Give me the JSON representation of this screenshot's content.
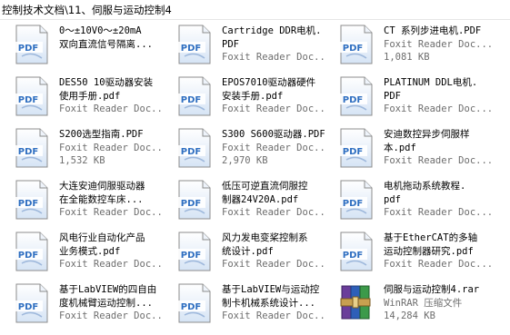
{
  "window": {
    "title": "控制技术文档\\11、伺服与运动控制4"
  },
  "files": [
    {
      "type": "pdf",
      "name_lines": [
        "0～±10V0～±20mA",
        "双向直流信号隔离..."
      ],
      "sub": ""
    },
    {
      "type": "pdf",
      "name_lines": [
        "Cartridge DDR电机.",
        "PDF"
      ],
      "sub": "Foxit Reader Doc..."
    },
    {
      "type": "pdf",
      "name_lines": [
        "CT 系列步进电机.PDF"
      ],
      "sub": "Foxit Reader Doc...",
      "size": "1,081 KB"
    },
    {
      "type": "pdf",
      "name_lines": [
        "DES50 10驱动器安装",
        "使用手册.pdf"
      ],
      "sub": "Foxit Reader Doc..."
    },
    {
      "type": "pdf",
      "name_lines": [
        "EPOS7010驱动器硬件",
        "安装手册.pdf"
      ],
      "sub": "Foxit Reader Doc..."
    },
    {
      "type": "pdf",
      "name_lines": [
        "PLATINUM DDL电机.",
        "PDF"
      ],
      "sub": "Foxit Reader Doc..."
    },
    {
      "type": "pdf",
      "name_lines": [
        "S200选型指南.PDF"
      ],
      "sub": "Foxit Reader Doc...",
      "size": "1,532 KB"
    },
    {
      "type": "pdf",
      "name_lines": [
        "S300 S600驱动器.PDF"
      ],
      "sub": "Foxit Reader Doc...",
      "size": "2,970 KB"
    },
    {
      "type": "pdf",
      "name_lines": [
        "安迪数控异步伺服样",
        "本.pdf"
      ],
      "sub": "Foxit Reader Doc..."
    },
    {
      "type": "pdf",
      "name_lines": [
        "大连安迪伺服驱动器",
        "在全能数控车床..."
      ],
      "sub": "Foxit Reader Doc..."
    },
    {
      "type": "pdf",
      "name_lines": [
        "低压可逆直流伺服控",
        "制器24V20A.pdf"
      ],
      "sub": "Foxit Reader Doc..."
    },
    {
      "type": "pdf",
      "name_lines": [
        "电机拖动系统教程.",
        "pdf"
      ],
      "sub": "Foxit Reader Doc..."
    },
    {
      "type": "pdf",
      "name_lines": [
        "风电行业自动化产品",
        "业务模式.pdf"
      ],
      "sub": "Foxit Reader Doc..."
    },
    {
      "type": "pdf",
      "name_lines": [
        "风力发电变桨控制系",
        "统设计.pdf"
      ],
      "sub": "Foxit Reader Doc..."
    },
    {
      "type": "pdf",
      "name_lines": [
        "基于EtherCAT的多轴",
        "运动控制器研究.pdf"
      ],
      "sub": "Foxit Reader Doc..."
    },
    {
      "type": "pdf",
      "name_lines": [
        "基于LabVIEW的四自由",
        "度机械臂运动控制..."
      ],
      "sub": "Foxit Reader Doc..."
    },
    {
      "type": "pdf",
      "name_lines": [
        "基于LabVIEW与运动控",
        "制卡机械系统设计..."
      ],
      "sub": "Foxit Reader Doc..."
    },
    {
      "type": "rar",
      "name_lines": [
        "伺服与运动控制4.rar"
      ],
      "sub": "WinRAR 压缩文件",
      "size": "14,284 KB"
    }
  ],
  "colors": {
    "pdf_border": "#8c8c8c",
    "pdf_bg_top": "#ffffff",
    "pdf_bg_bottom": "#d6e4f5",
    "pdf_label": "#2f6fc1",
    "rar_purple": "#6a3d9a",
    "rar_blue": "#2e5fb8",
    "secondary_text": "#6d6d6d"
  }
}
